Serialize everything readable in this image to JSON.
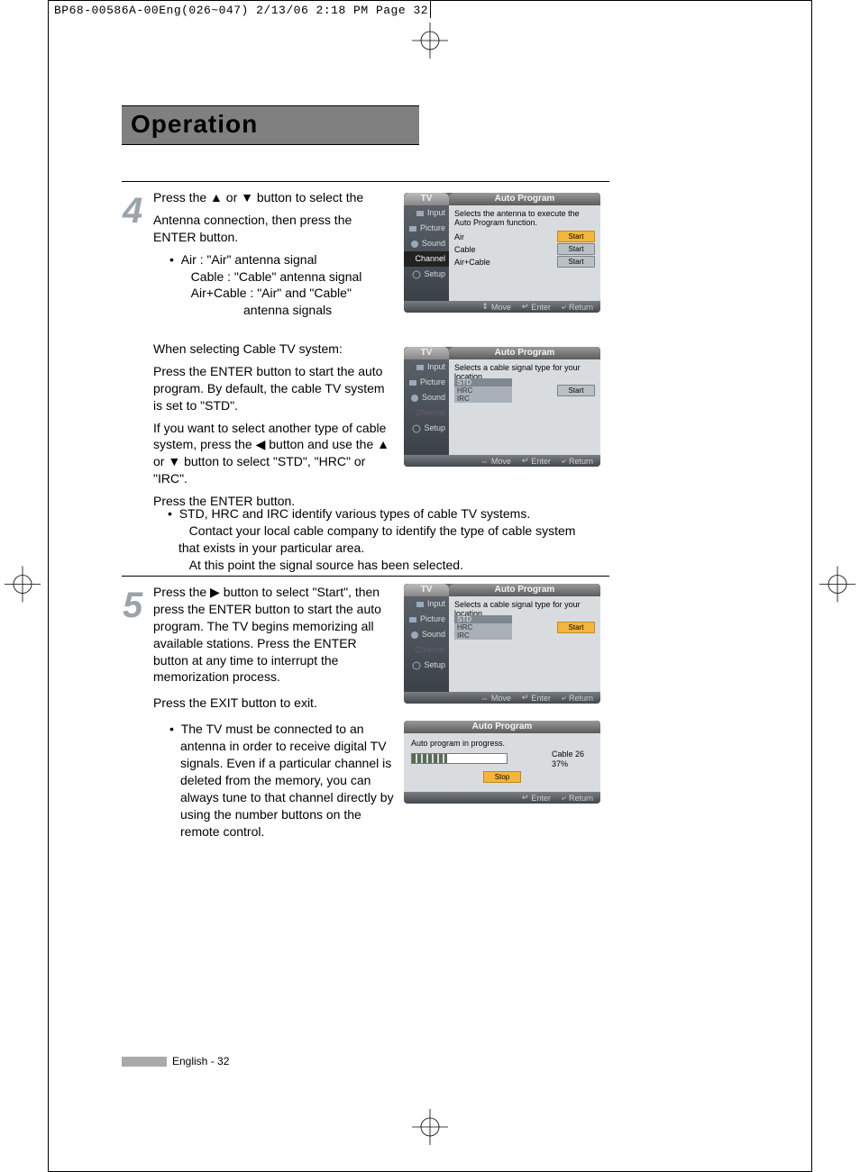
{
  "slug": "BP68-00586A-00Eng(026~047)  2/13/06  2:18 PM  Page 32",
  "section_title": "Operation",
  "step4": {
    "num": "4",
    "p1_a": "Press the ",
    "p1_b": " or ",
    "p1_c": " button to select the",
    "p2": "Antenna connection, then press the ENTER button.",
    "li1": "Air : \"Air\" antenna signal",
    "li2": "Cable : \"Cable\" antenna signal",
    "li3": "Air+Cable : \"Air\" and \"Cable\"",
    "li3b": "antenna signals",
    "mid1": "When selecting Cable TV system:",
    "mid2": "Press the ENTER button to start the auto program. By default, the cable TV system is set to \"STD\".",
    "mid3_a": "If you want to select another type of cable system, press the ",
    "mid3_b": " button and use the ",
    "mid3_c": " or ",
    "mid3_d": " button to select \"STD\", \"HRC\" or \"IRC\".",
    "mid4": "Press the ENTER button.",
    "note1": "STD, HRC and IRC identify various types of cable TV systems.",
    "note2": "Contact your local cable company to identify the type of cable system that exists in your particular area.",
    "note3": "At this point the signal source has been selected."
  },
  "step5": {
    "num": "5",
    "p1_a": "Press the ",
    "p1_b": " button to select \"Start\", then press the ENTER button to start the auto program. The TV begins memorizing all available stations. Press the ENTER button at any time to interrupt the memorization process.",
    "p2": "Press the EXIT button to exit.",
    "note": "The TV must be connected to an antenna in order to receive digital TV signals. Even if a particular channel is deleted from the memory, you can always tune to that channel directly by using the number buttons on the remote control."
  },
  "osd": {
    "tv": "TV",
    "title": "Auto Program",
    "side": {
      "input": "Input",
      "picture": "Picture",
      "sound": "Sound",
      "channel": "Channel",
      "setup": "Setup"
    },
    "foot": {
      "move": "Move",
      "enter": "Enter",
      "return": "Return"
    },
    "a": {
      "cap": "Selects the antenna to execute the Auto Program function.",
      "rows": [
        {
          "lbl": "Air",
          "btn": "Start"
        },
        {
          "lbl": "Cable",
          "btn": "Start"
        },
        {
          "lbl": "Air+Cable",
          "btn": "Start"
        }
      ]
    },
    "b": {
      "cap": "Selects a cable signal type for your location.",
      "options": [
        "STD",
        "HRC",
        "IRC"
      ],
      "btn": "Start"
    },
    "c": {
      "cap": "Selects a cable signal type for your location.",
      "options": [
        "STD",
        "HRC",
        "IRC"
      ],
      "btn": "Start"
    },
    "d": {
      "cap": "Auto program in progress.",
      "chan": "Cable 26",
      "pct": "37%",
      "stop": "Stop"
    }
  },
  "footer": "English - 32"
}
